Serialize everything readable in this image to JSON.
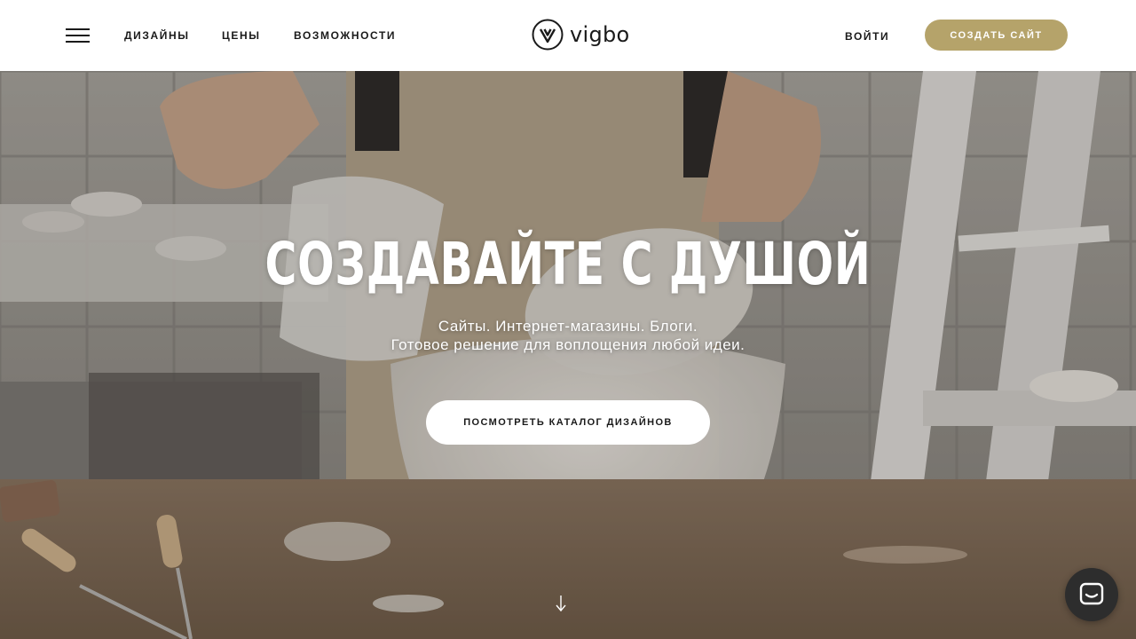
{
  "header": {
    "nav": {
      "designs": "ДИЗАЙНЫ",
      "prices": "ЦЕНЫ",
      "features": "ВОЗМОЖНОСТИ"
    },
    "logo_text": "vigbo",
    "login": "ВОЙТИ",
    "create_site": "СОЗДАТЬ САЙТ"
  },
  "hero": {
    "title": "СОЗДАВАЙТЕ С ДУШОЙ",
    "subtitle_line1": "Сайты. Интернет-магазины. Блоги.",
    "subtitle_line2": "Готовое решение для воплощения любой идеи.",
    "catalog_button": "ПОСМОТРЕТЬ КАТАЛОГ ДИЗАЙНОВ"
  },
  "colors": {
    "accent": "#b5a36a",
    "header_bg": "#ffffff",
    "chat_button": "#2d2d2d"
  },
  "icons": [
    "menu-icon",
    "vigbo-logo-icon",
    "arrow-down-icon",
    "chat-icon"
  ]
}
